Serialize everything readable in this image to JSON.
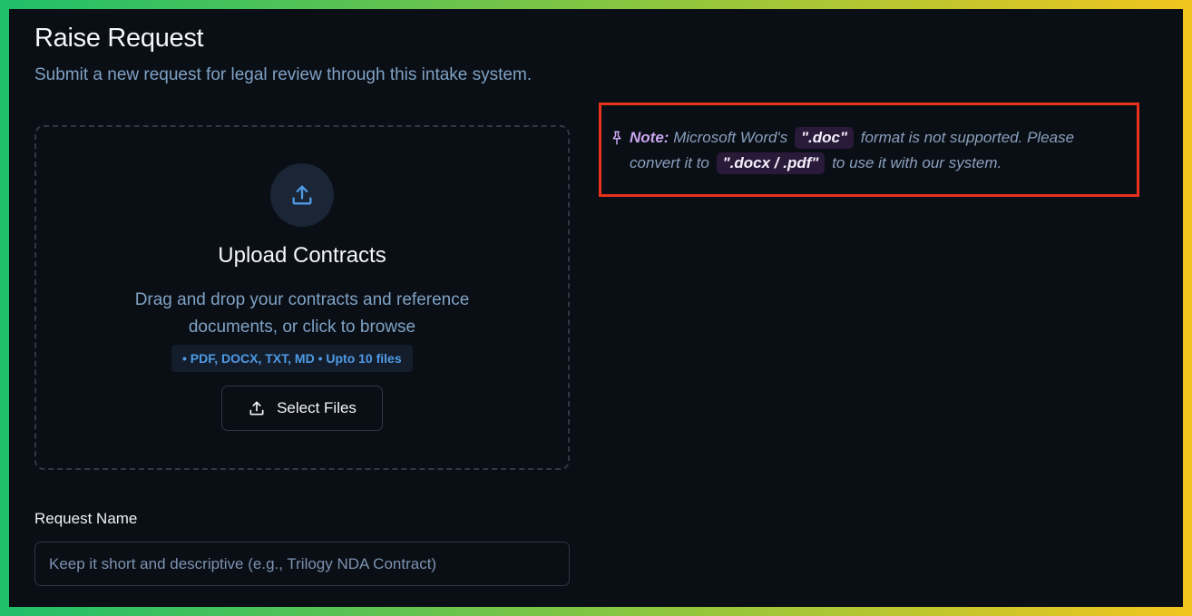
{
  "page": {
    "title": "Raise Request",
    "subtitle": "Submit a new request for legal review through this intake system."
  },
  "upload": {
    "icon": "upload-icon",
    "heading": "Upload Contracts",
    "description": "Drag and drop your contracts and reference documents, or click to browse",
    "formats": "• PDF, DOCX, TXT, MD • Upto 10 files",
    "button_label": "Select Files"
  },
  "note": {
    "icon": "pin-icon",
    "label": "Note:",
    "text_1": "Microsoft Word's",
    "code_1": "\".doc\"",
    "text_2": "format is not supported. Please convert it to",
    "code_2": "\".docx / .pdf\"",
    "text_3": "to use it with our system.",
    "highlight_color": "#e8321e"
  },
  "form": {
    "request_name_label": "Request Name",
    "request_name_placeholder": "Keep it short and descriptive (e.g., Trilogy NDA Contract)",
    "request_name_value": ""
  },
  "colors": {
    "background": "#0a0e15",
    "accent_blue": "#4f9be6",
    "muted_text": "#7fa2c4"
  }
}
